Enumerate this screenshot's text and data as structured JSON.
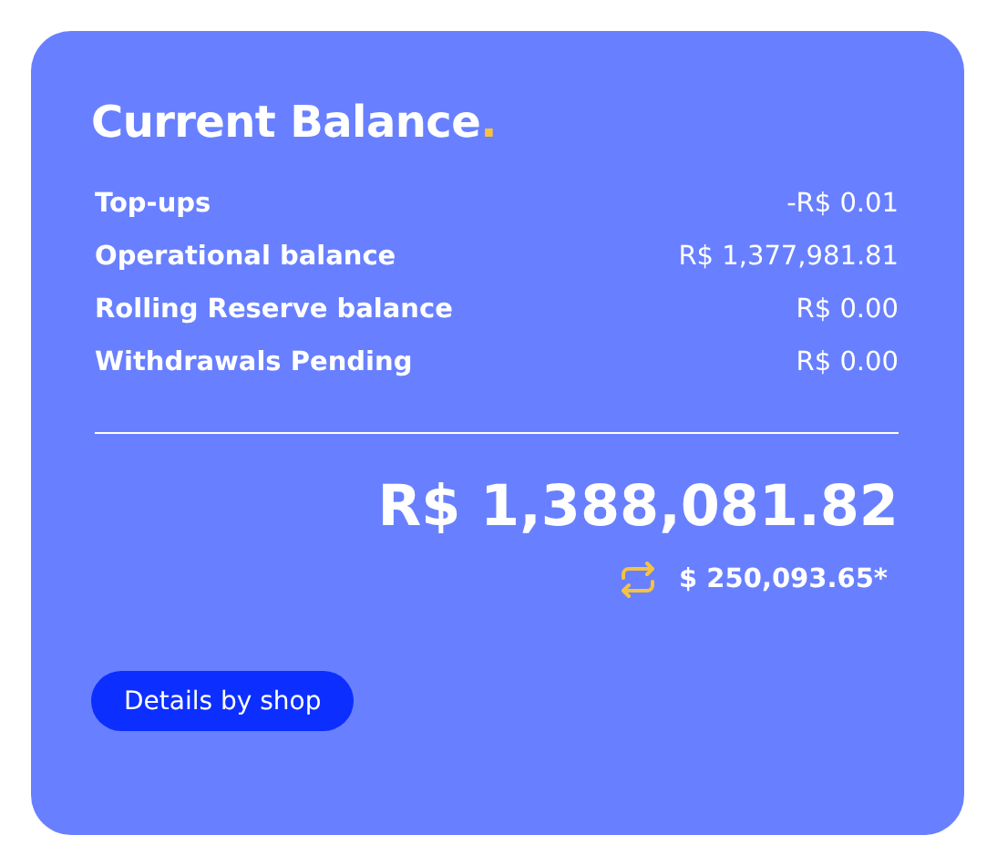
{
  "title": "Current Balance",
  "title_mark": ".",
  "rows": [
    {
      "label": "Top-ups",
      "value": "-R$ 0.01"
    },
    {
      "label": "Operational balance",
      "value": "R$ 1,377,981.81"
    },
    {
      "label": "Rolling Reserve balance",
      "value": "R$ 0.00"
    },
    {
      "label": "Withdrawals Pending",
      "value": "R$ 0.00"
    }
  ],
  "total": "R$ 1,388,081.82",
  "converted": "$ 250,093.65*",
  "button": "Details by shop"
}
